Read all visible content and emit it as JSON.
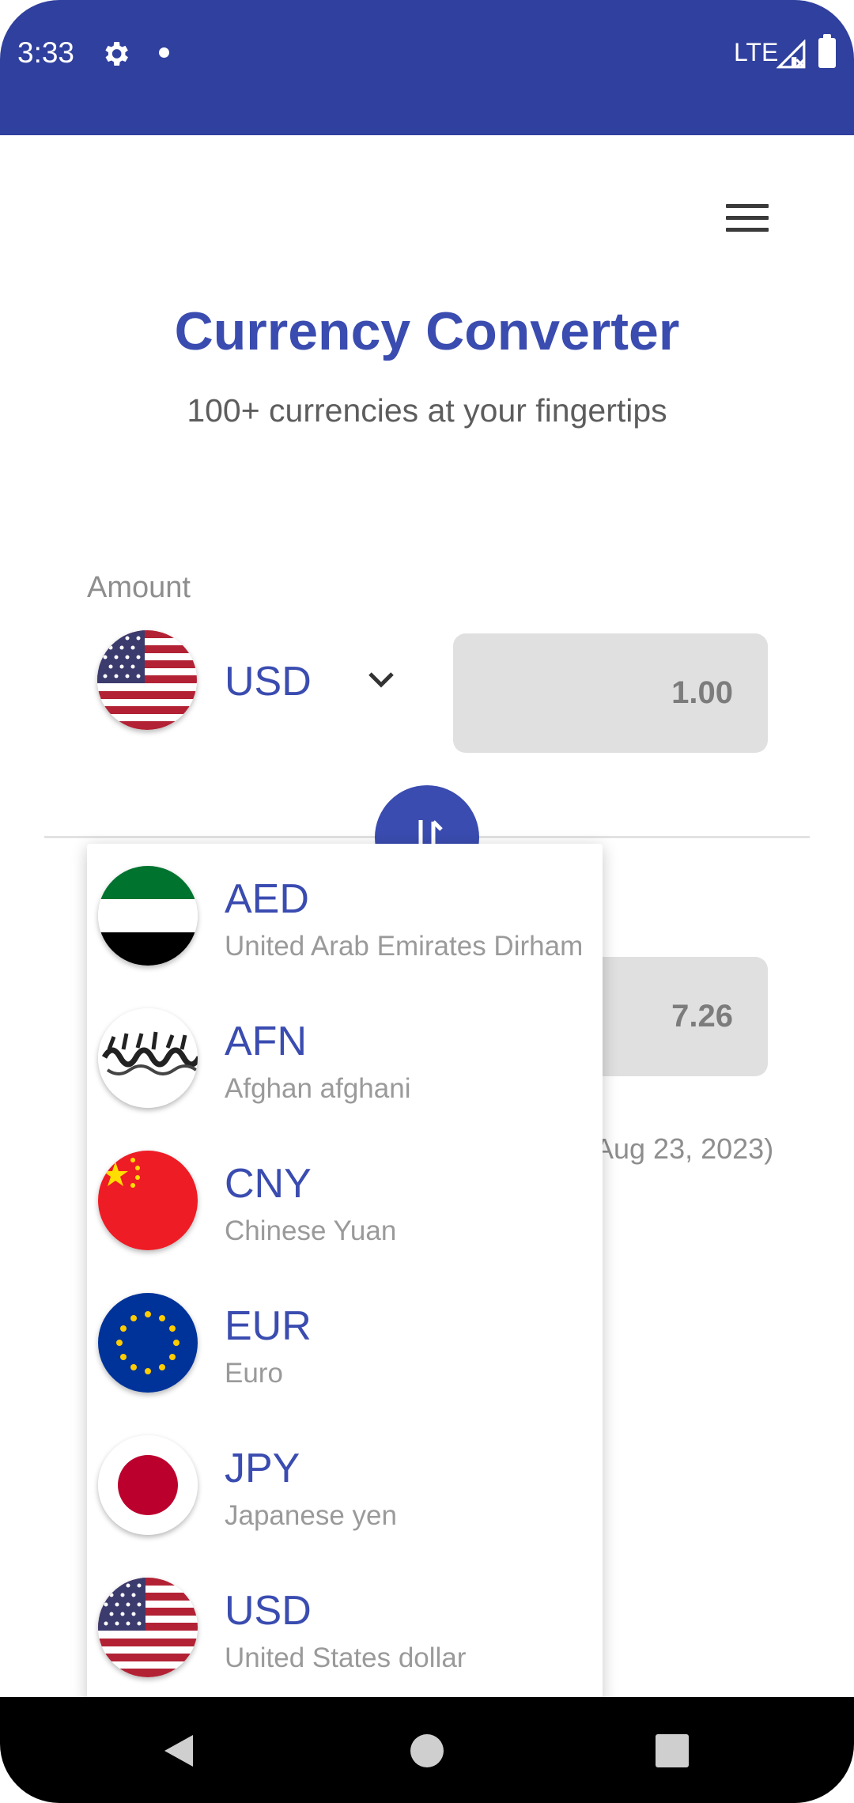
{
  "status_bar": {
    "time": "3:33",
    "network": "LTE"
  },
  "header": {
    "title": "Currency Converter",
    "subtitle": "100+ currencies at your fingertips"
  },
  "converter": {
    "amount_label": "Amount",
    "from_currency": "USD",
    "amount_value": "1.00",
    "converted_value": "7.26",
    "rate_date_fragment": "Aug 23, 2023)"
  },
  "dropdown": {
    "items": [
      {
        "code": "AED",
        "name": "United Arab Emirates Dirham",
        "flag": "uae-flag-icon"
      },
      {
        "code": "AFN",
        "name": "Afghan afghani",
        "flag": "afghanistan-flag-icon"
      },
      {
        "code": "CNY",
        "name": "Chinese Yuan",
        "flag": "china-flag-icon"
      },
      {
        "code": "EUR",
        "name": "Euro",
        "flag": "eu-flag-icon"
      },
      {
        "code": "JPY",
        "name": "Japanese yen",
        "flag": "japan-flag-icon"
      },
      {
        "code": "USD",
        "name": "United States dollar",
        "flag": "usa-flag-icon"
      }
    ]
  },
  "colors": {
    "primary": "#30409e",
    "accent_text": "#3a4cb0",
    "input_bg": "#e0e0e0"
  }
}
